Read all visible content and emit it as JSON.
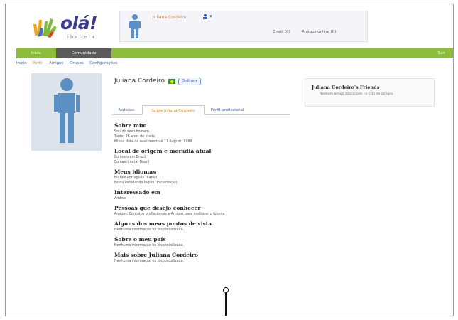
{
  "header": {
    "logo_text": "olá!",
    "logo_sub": "ibabela",
    "user_name": "Juliana Cordeiro",
    "status_icon": "person-icon",
    "email_label": "Email (0)",
    "friends_online_label": "Amigos online (0)"
  },
  "nav": {
    "tabs": [
      "Início",
      "Comunidade"
    ],
    "logout_label": "Sair",
    "brand_color": "#8cbc3c"
  },
  "subnav": {
    "items": [
      "Início",
      "Perfil",
      "Amigos",
      "Grupos",
      "Configurações"
    ]
  },
  "profile": {
    "name": "Juliana Cordeiro",
    "online_label": "Online",
    "tabs": [
      "Notícias",
      "Sobre Juliana Cordeiro",
      "Perfil profissional"
    ]
  },
  "sections": [
    {
      "title": "Sobre mim",
      "lines": [
        "Sou do sexo homem.",
        "Tenho 26 anos de idade.",
        "Minha data de nascimento é 11 August, 1988"
      ]
    },
    {
      "title": "Local de origem e moradia atual",
      "lines": [
        "Eu moro em Brazil.",
        "Eu nasci no(a) Brazil"
      ]
    },
    {
      "title": "Meus idiomas",
      "lines": [
        "Eu falo Português (nativo)",
        "Estou estudando Inglês (Iniciante(a))"
      ]
    },
    {
      "title": "Interessado em",
      "lines": [
        "Ambos"
      ]
    },
    {
      "title": "Pessoas que desejo conhecer",
      "lines": [
        "Amigos, Contatos profissionais e Amigos para melhorar o idioma"
      ]
    },
    {
      "title": "Alguns dos meus pontos de vista",
      "lines": [
        "Nenhuma informação foi disponibilizada."
      ]
    },
    {
      "title": "Sobre o meu país",
      "lines": [
        "Nenhuma informação foi disponibilizada."
      ]
    },
    {
      "title": "Mais sobre Juliana Cordeiro",
      "lines": [
        "Nenhuma informação foi disponibilizada."
      ]
    }
  ],
  "friends_box": {
    "title": "Juliana Cordeiro's Friends",
    "text": "Nenhum amigo adicionado na lista de amigos."
  }
}
